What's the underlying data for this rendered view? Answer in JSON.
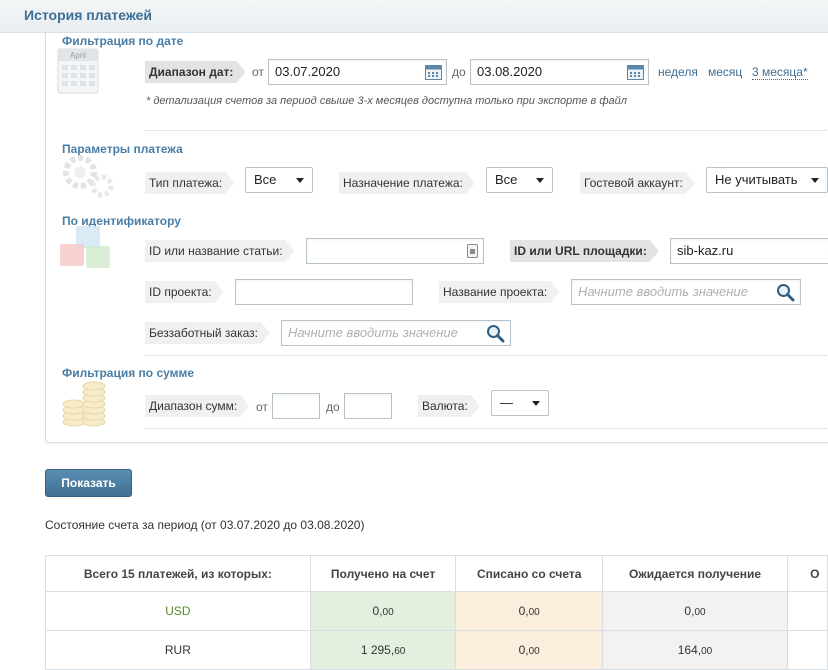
{
  "page": {
    "title": "История платежей"
  },
  "date_filter": {
    "section_title": "Фильтрация по дате",
    "calendar_month": "April",
    "range_label": "Диапазон дат:",
    "from_label": "от",
    "from_value": "03.07.2020",
    "to_label": "до",
    "to_value": "03.08.2020",
    "quick_links": [
      "неделя",
      "месяц",
      "3 месяца*"
    ],
    "note": "* детализация счетов за период свыше 3-х месяцев доступна только при экспорте в файл"
  },
  "payment_params": {
    "section_title": "Параметры платежа",
    "type_label": "Тип платежа:",
    "type_value": "Все",
    "purpose_label": "Назначение платежа:",
    "purpose_value": "Все",
    "guest_label": "Гостевой аккаунт:",
    "guest_value": "Не учитывать"
  },
  "by_id": {
    "section_title": "По идентификатору",
    "article_label": "ID или название статьи:",
    "article_value": "",
    "site_label": "ID или URL площадки:",
    "site_value": "sib-kaz.ru",
    "project_id_label": "ID проекта:",
    "project_id_value": "",
    "project_name_label": "Название проекта:",
    "project_name_placeholder": "Начните вводить значение",
    "order_label": "Беззаботный заказ:",
    "order_placeholder": "Начните вводить значение"
  },
  "sum_filter": {
    "section_title": "Фильтрация по сумме",
    "range_label": "Диапазон сумм:",
    "from_label": "от",
    "to_label": "до",
    "currency_label": "Валюта:",
    "currency_value": "—"
  },
  "actions": {
    "show_label": "Показать"
  },
  "summary": {
    "period_text": "Состояние счета за период (от 03.07.2020 до 03.08.2020)",
    "headers": [
      "Всего 15 платежей, из которых:",
      "Получено на счет",
      "Списано со счета",
      "Ожидается получение",
      "О"
    ],
    "rows": [
      {
        "currency": "USD",
        "received_int": "0,",
        "received_dec": "00",
        "debited_int": "0,",
        "debited_dec": "00",
        "expected_int": "0,",
        "expected_dec": "00"
      },
      {
        "currency": "RUR",
        "received_int": "1 295,",
        "received_dec": "60",
        "debited_int": "0,",
        "debited_dec": "00",
        "expected_int": "164,",
        "expected_dec": "00"
      }
    ]
  },
  "colors": {
    "accent": "#3d6e94",
    "button": "#4a7ea6",
    "received_bg": "#e3f0df",
    "debited_bg": "#fbeedd",
    "expected_bg": "#f2f2f2"
  }
}
